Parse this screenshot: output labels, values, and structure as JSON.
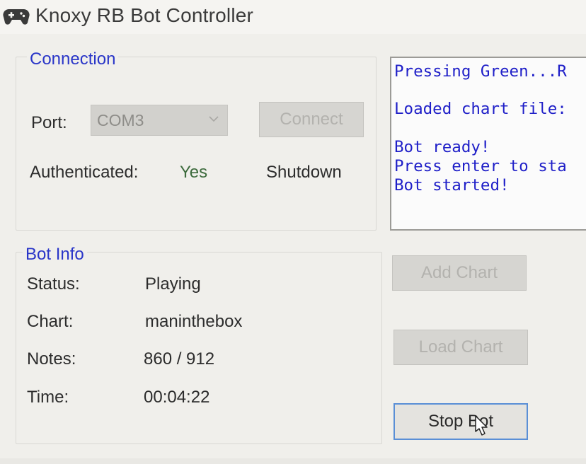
{
  "window": {
    "title": "Knoxy RB Bot Controller",
    "icon": "gamepad-icon"
  },
  "connection": {
    "group_title": "Connection",
    "port_label": "Port:",
    "port_value": "COM3",
    "connect_label": "Connect",
    "authenticated_label": "Authenticated:",
    "authenticated_value": "Yes",
    "shutdown_label": "Shutdown"
  },
  "log": {
    "lines": [
      "Pressing Green...R",
      "",
      "Loaded chart file:",
      "",
      "Bot ready!",
      "Press enter to sta",
      "Bot started!"
    ]
  },
  "bot_info": {
    "group_title": "Bot Info",
    "status_label": "Status:",
    "status_value": "Playing",
    "chart_label": "Chart:",
    "chart_value": "maninthebox",
    "notes_label": "Notes:",
    "notes_value": "860 / 912",
    "time_label": "Time:",
    "time_value": "00:04:22"
  },
  "buttons": {
    "add_chart": "Add Chart",
    "load_chart": "Load Chart",
    "stop_bot": "Stop Bot"
  },
  "colors": {
    "accent_blue_text": "#2a36c8",
    "log_text": "#1f1fc8",
    "yes_green": "#3d6b3d",
    "focus_border": "#5a8fd6"
  }
}
